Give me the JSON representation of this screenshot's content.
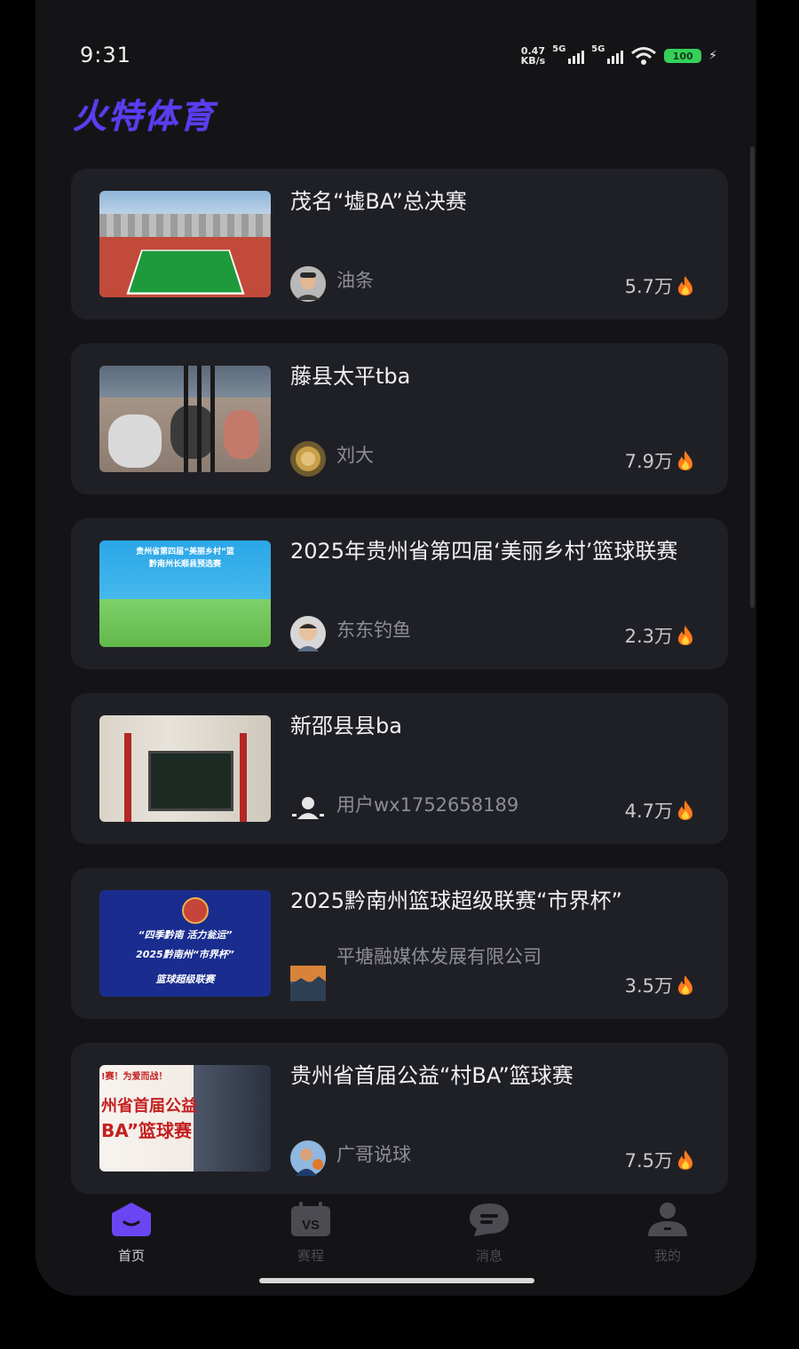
{
  "status_bar": {
    "time": "9:31",
    "net_speed_value": "0.47",
    "net_speed_unit": "KB/s",
    "signal1": "5G",
    "signal2": "5G",
    "battery": "100"
  },
  "app": {
    "title": "火特体育",
    "accent": "#5b3cf0"
  },
  "games": [
    {
      "title": "茂名“墟BA”总决赛",
      "author": "油条",
      "views": "5.7万",
      "avatar": "face-avatar-icon"
    },
    {
      "title": "藤县太平tba",
      "author": "刘大",
      "views": "7.9万",
      "avatar": "medal-avatar-icon"
    },
    {
      "title": "2025年贵州省第四届‘美丽乡村’篮球联赛",
      "author": "东东钓鱼",
      "views": "2.3万",
      "avatar": "child-avatar-icon"
    },
    {
      "title": "新邵县县ba",
      "author": "用户wx1752658189",
      "views": "4.7万",
      "avatar": "default-user-icon"
    },
    {
      "title": "2025黔南州篮球超级联赛“市界杯”",
      "author": "平塘融媒体发展有限公司",
      "views": "3.5万",
      "avatar": "landscape-avatar-icon"
    },
    {
      "title": "贵州省首届公益“村BA”篮球赛",
      "author": "广哥说球",
      "views": "7.5万",
      "avatar": "player-avatar-icon"
    }
  ],
  "thumbnails": {
    "poster3_line1": "贵州省第四届“美丽乡村”篮",
    "poster3_line2": "黔南州长顺县预选赛",
    "poster5_line1": "“四季黔南 活力瓮运”",
    "poster5_line2": "2025黔南州“市界杯”",
    "poster5_line3": "篮球超级联赛",
    "poster6_line1": "!赛！为爱而战！",
    "poster6_line2": "州省首届公益",
    "poster6_line3": "BA”篮球赛"
  },
  "tabs": [
    {
      "label": "首页",
      "icon": "home-icon",
      "active": true
    },
    {
      "label": "赛程",
      "icon": "vs-schedule-icon",
      "active": false
    },
    {
      "label": "消息",
      "icon": "message-icon",
      "active": false
    },
    {
      "label": "我的",
      "icon": "profile-icon",
      "active": false
    }
  ]
}
